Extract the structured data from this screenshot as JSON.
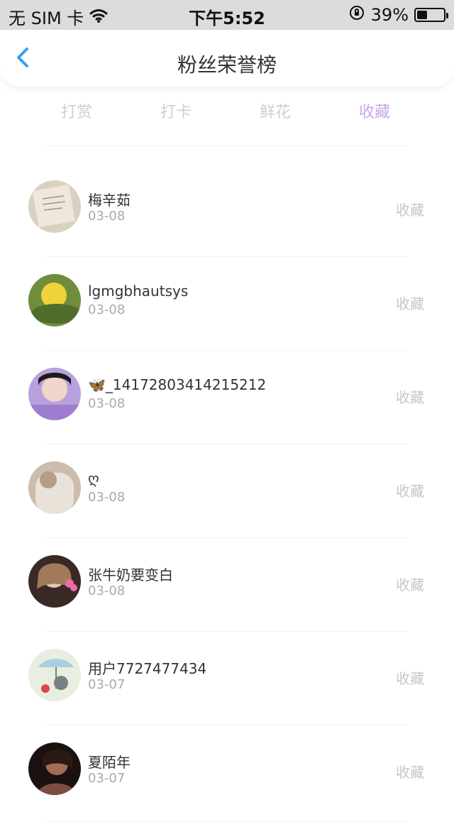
{
  "status_bar": {
    "carrier": "无 SIM 卡",
    "time": "下午5:52",
    "battery_percent": "39%"
  },
  "header": {
    "title": "粉丝荣誉榜"
  },
  "tabs": [
    {
      "label": "打赏"
    },
    {
      "label": "打卡"
    },
    {
      "label": "鲜花"
    },
    {
      "label": "收藏"
    }
  ],
  "active_tab": "收藏",
  "list": [
    {
      "name": "梅辛茹",
      "date": "03-08",
      "action": "收藏"
    },
    {
      "name": "lgmgbhautsys",
      "date": "03-08",
      "action": "收藏"
    },
    {
      "name": "🦋_14172803414215212",
      "date": "03-08",
      "action": "收藏"
    },
    {
      "name": "ღ",
      "date": "03-08",
      "action": "收藏"
    },
    {
      "name": "张牛奶要变白",
      "date": "03-08",
      "action": "收藏"
    },
    {
      "name": "用户7727477434",
      "date": "03-07",
      "action": "收藏"
    },
    {
      "name": "夏陌年",
      "date": "03-07",
      "action": "收藏"
    }
  ],
  "colors": {
    "active_tab": "#c9a6e6",
    "inactive_tab": "#cfcfcf",
    "back_arrow": "#3a9ff2"
  }
}
